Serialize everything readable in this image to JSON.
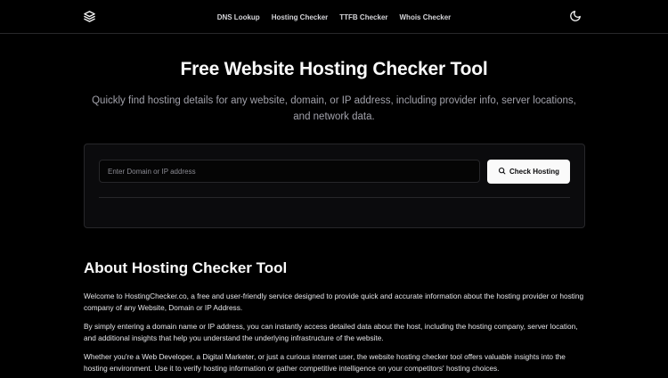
{
  "nav": {
    "links": [
      "DNS Lookup",
      "Hosting Checker",
      "TTFB Checker",
      "Whois Checker"
    ]
  },
  "icons": {
    "logo": "layers-icon",
    "theme": "moon-icon",
    "search": "search-icon"
  },
  "hero": {
    "title": "Free Website Hosting Checker Tool",
    "subtitle": "Quickly find hosting details for any website, domain, or IP address, including provider info, server locations, and network data."
  },
  "search": {
    "placeholder": "Enter Domain or IP address",
    "value": "",
    "button_label": "Check Hosting"
  },
  "about": {
    "heading": "About Hosting Checker Tool",
    "paragraphs": [
      "Welcome to HostingChecker.co, a free and user-friendly service designed to provide quick and accurate information about the hosting provider or hosting company of any Website, Domain or IP Address.",
      "By simply entering a domain name or IP address, you can instantly access detailed data about the host, including the hosting company, server location, and additional insights that help you understand the underlying infrastructure of the website.",
      "Whether you're a Web Developer, a Digital Marketer, or just a curious internet user, the website hosting checker tool offers valuable insights into the hosting environment. Use it to verify hosting information or gather competitive intelligence on your competitors' hosting choices."
    ]
  },
  "colors": {
    "background": "#000000",
    "card": "#0b0b0d",
    "border": "#27272a",
    "muted_text": "#a1a1aa",
    "button_bg": "#fafafa"
  }
}
